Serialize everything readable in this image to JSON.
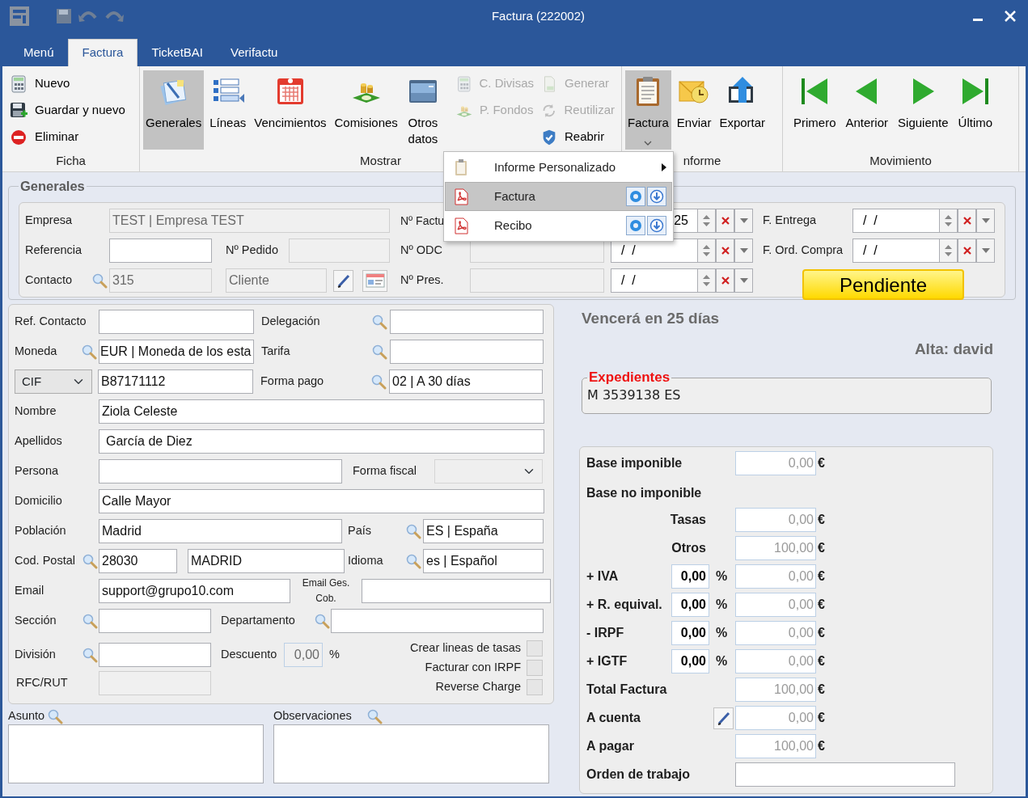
{
  "window": {
    "title": "Factura (222002)"
  },
  "ribbon_tabs": [
    {
      "label": "Menú",
      "selected": false
    },
    {
      "label": "Factura",
      "selected": true
    },
    {
      "label": "TicketBAI",
      "selected": false
    },
    {
      "label": "Verifactu",
      "selected": false
    }
  ],
  "ribbon": {
    "ficha": {
      "label": "Ficha",
      "buttons": [
        {
          "label": "Nuevo"
        },
        {
          "label": "Guardar y nuevo"
        },
        {
          "label": "Eliminar"
        }
      ]
    },
    "mostrar": {
      "label": "Mostrar",
      "buttons": [
        {
          "label": "Generales",
          "selected": true
        },
        {
          "label": "Líneas",
          "selected": false
        },
        {
          "label": "Vencimientos",
          "selected": false
        },
        {
          "label": "Comisiones",
          "selected": false
        },
        {
          "label": "Otros datos",
          "selected": false
        }
      ],
      "small_buttons": [
        {
          "label": "C. Divisas",
          "disabled": true
        },
        {
          "label": "P. Fondos",
          "disabled": true
        },
        {
          "label": "Generar",
          "disabled": true
        },
        {
          "label": "Reutilizar",
          "disabled": true
        },
        {
          "label": "Reabrir",
          "disabled": false
        }
      ]
    },
    "informe": {
      "label": "nforme",
      "buttons": [
        {
          "label": "Factura",
          "selected": true
        },
        {
          "label": "Enviar",
          "selected": false
        },
        {
          "label": "Exportar",
          "selected": false
        }
      ]
    },
    "movimiento": {
      "label": "Movimiento",
      "buttons": [
        {
          "label": "Primero"
        },
        {
          "label": "Anterior"
        },
        {
          "label": "Siguiente"
        },
        {
          "label": "Último"
        }
      ]
    }
  },
  "dropdown_menu": [
    {
      "label": "Informe Personalizado",
      "kind": "submenu",
      "selected": false
    },
    {
      "label": "Factura",
      "kind": "report",
      "selected": true
    },
    {
      "label": "Recibo",
      "kind": "report",
      "selected": false
    }
  ],
  "generales": {
    "title": "Generales",
    "empresa": {
      "label": "Empresa",
      "value": "TEST | Empresa TEST",
      "disabled": true
    },
    "referencia": {
      "label": "Referencia"
    },
    "n_pedido": {
      "label": "Nº Pedido",
      "disabled": true
    },
    "contacto": {
      "label": "Contacto",
      "value": "315",
      "disabled": true
    },
    "cliente": {
      "value": "Cliente",
      "disabled": true
    },
    "n_factura": {
      "label": "Nº Factu",
      "date": "25"
    },
    "n_odc": {
      "label": "Nº ODC",
      "disabled": true,
      "date": "/  /"
    },
    "n_pres": {
      "label": "Nº Pres.",
      "disabled": true,
      "date": "/  /"
    },
    "f_entrega": {
      "label": "F. Entrega",
      "date": "/  /"
    },
    "f_ord_compra": {
      "label": "F. Ord. Compra",
      "date": "/  /"
    },
    "status": "Pendiente"
  },
  "datos": {
    "ref_contacto": {
      "label": "Ref. Contacto"
    },
    "delegacion": {
      "label": "Delegación"
    },
    "moneda": {
      "label": "Moneda",
      "value": "EUR | Moneda de los esta"
    },
    "tarifa": {
      "label": "Tarifa"
    },
    "documento": {
      "type": "CIF",
      "value": "B87171112"
    },
    "forma_pago": {
      "label": "Forma pago",
      "value": "02 | A 30 días"
    },
    "nombre": {
      "label": "Nombre",
      "value": "Ziola Celeste"
    },
    "apellidos": {
      "label": "Apellidos",
      "value": "García de Diez"
    },
    "persona": {
      "label": "Persona"
    },
    "forma_fiscal": {
      "label": "Forma fiscal",
      "disabled": true
    },
    "domicilio": {
      "label": "Domicilio",
      "value": "Calle Mayor"
    },
    "poblacion": {
      "label": "Población",
      "value": "Madrid"
    },
    "pais": {
      "label": "País",
      "value": "ES | España"
    },
    "cod_postal": {
      "label": "Cod. Postal",
      "value": "28030"
    },
    "provincia": {
      "value": "MADRID"
    },
    "idioma": {
      "label": "Idioma",
      "value": "es | Español"
    },
    "email": {
      "label": "Email",
      "value": "support@grupo10.com"
    },
    "email_ges_cob": {
      "label": "Email Ges. Cob."
    },
    "seccion": {
      "label": "Sección"
    },
    "departamento": {
      "label": "Departamento"
    },
    "division": {
      "label": "División"
    },
    "descuento": {
      "label": "Descuento",
      "value": "0,00",
      "disabled": true,
      "unit": "%"
    },
    "rfc_rut": {
      "label": "RFC/RUT",
      "disabled": true
    },
    "opciones": [
      {
        "label": "Crear lineas de tasas",
        "checked": false
      },
      {
        "label": "Facturar con IRPF",
        "checked": false
      },
      {
        "label": "Reverse Charge",
        "checked": false
      }
    ]
  },
  "notas": {
    "asunto": {
      "label": "Asunto"
    },
    "observaciones": {
      "label": "Observaciones"
    }
  },
  "vencimiento": "Vencerá en 25 días",
  "alta": "Alta: david",
  "expedientes": {
    "title": "Expedientes",
    "value": "M 3539138 ES"
  },
  "totals": {
    "rows": [
      {
        "kind": "amount",
        "label": "Base imponible",
        "amount": "0,00",
        "currency": "€"
      },
      {
        "kind": "header",
        "label": "Base no imponible"
      },
      {
        "kind": "sub",
        "label": "Tasas",
        "amount": "0,00",
        "currency": "€"
      },
      {
        "kind": "sub",
        "label": "Otros",
        "amount": "100,00",
        "currency": "€"
      },
      {
        "kind": "percent",
        "label": "+ IVA",
        "rate": "0,00",
        "unit": "%",
        "amount": "0,00",
        "currency": "€"
      },
      {
        "kind": "percent",
        "label": "+ R. equival.",
        "rate": "0,00",
        "unit": "%",
        "amount": "0,00",
        "currency": "€"
      },
      {
        "kind": "percent",
        "label": "- IRPF",
        "rate": "0,00",
        "unit": "%",
        "amount": "0,00",
        "currency": "€"
      },
      {
        "kind": "percent",
        "label": "+ IGTF",
        "rate": "0,00",
        "unit": "%",
        "amount": "0,00",
        "currency": "€"
      },
      {
        "kind": "amount",
        "label": "Total Factura",
        "amount": "100,00",
        "currency": "€"
      },
      {
        "kind": "edit",
        "label": "A cuenta",
        "amount": "0,00",
        "currency": "€"
      },
      {
        "kind": "amount",
        "label": "A pagar",
        "amount": "100,00",
        "currency": "€"
      },
      {
        "kind": "text",
        "label": "Orden de trabajo"
      }
    ]
  }
}
